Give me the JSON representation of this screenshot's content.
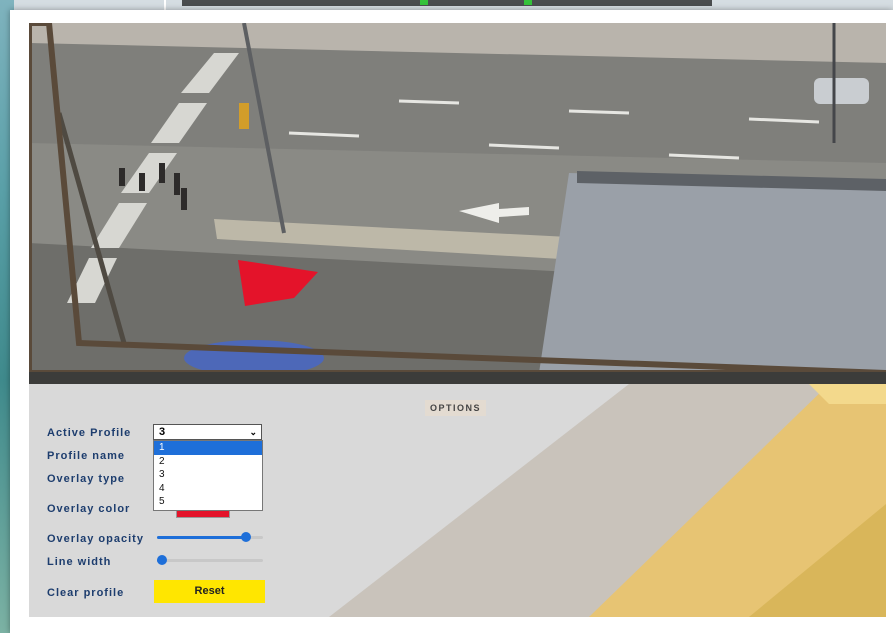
{
  "options_label": "OPTIONS",
  "form": {
    "active_profile_label": "Active Profile",
    "profile_name_label": "Profile name",
    "overlay_type_label": "Overlay type",
    "overlay_color_label": "Overlay color",
    "overlay_opacity_label": "Overlay opacity",
    "line_width_label": "Line width",
    "clear_profile_label": "Clear profile"
  },
  "active_profile": {
    "selected": "3",
    "options": [
      "1",
      "2",
      "3",
      "4",
      "5"
    ],
    "highlighted": "1"
  },
  "overlay_color": "#e4132a",
  "overlay_opacity_fraction": 0.88,
  "line_width_fraction": 0.0,
  "reset_label": "Reset",
  "colors": {
    "accent_blue": "#1e6fd9",
    "reset_yellow": "#ffe600",
    "label_navy": "#1d3d6e"
  }
}
